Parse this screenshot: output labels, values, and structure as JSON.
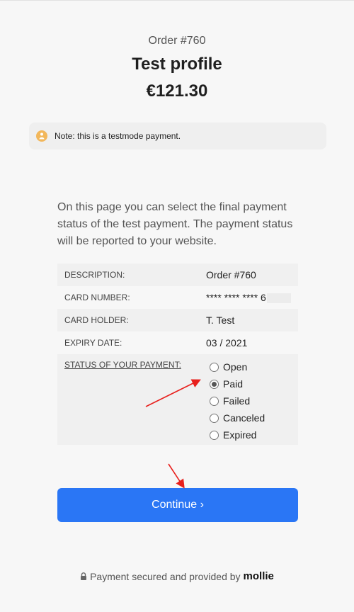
{
  "header": {
    "order_number": "Order #760",
    "profile_name": "Test profile",
    "amount": "€121.30"
  },
  "note": {
    "icon": "person-icon",
    "text": "Note: this is a testmode payment.",
    "accent_color": "#f2b75b"
  },
  "intro": "On this page you can select the final payment status of the test payment. The payment status will be reported to your website.",
  "details": {
    "description_label": "DESCRIPTION:",
    "description_value": "Order #760",
    "card_number_label": "CARD NUMBER:",
    "card_number_value": "**** **** **** 6",
    "card_holder_label": "CARD HOLDER:",
    "card_holder_value": "T. Test",
    "expiry_label": "EXPIRY DATE:",
    "expiry_value": "03 / 2021",
    "status_label": "STATUS OF YOUR PAYMENT:"
  },
  "status_options": [
    {
      "label": "Open",
      "checked": false
    },
    {
      "label": "Paid",
      "checked": true
    },
    {
      "label": "Failed",
      "checked": false
    },
    {
      "label": "Canceled",
      "checked": false
    },
    {
      "label": "Expired",
      "checked": false
    }
  ],
  "continue_button": "Continue ›",
  "footer": {
    "text": "Payment secured and provided by",
    "brand": "mollie"
  },
  "colors": {
    "primary_button": "#2a76f5",
    "annotation_arrow": "#e8201d"
  }
}
